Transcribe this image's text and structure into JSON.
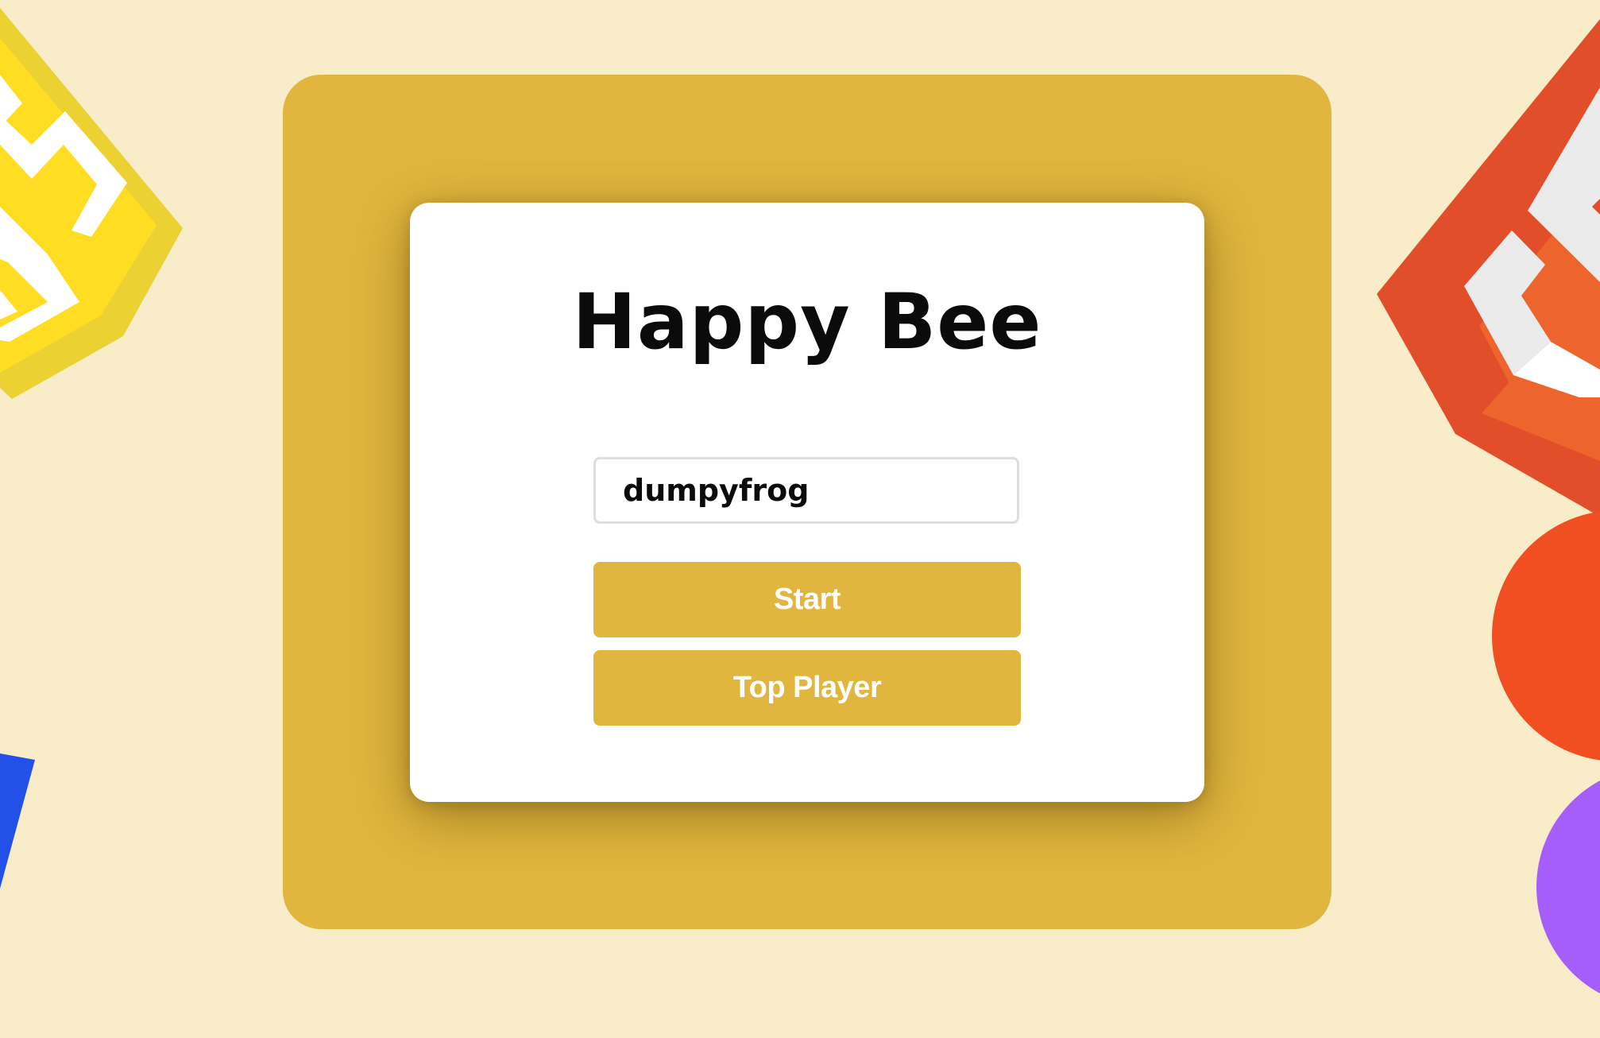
{
  "app": {
    "title": "Happy Bee"
  },
  "login_form": {
    "username_value": "dumpyfrog",
    "start_label": "Start",
    "top_player_label": "Top Player"
  },
  "colors": {
    "page_background": "#f8ecc9",
    "frame": "#e1b63e",
    "card": "#ffffff",
    "button": "#e1b63e",
    "button_text": "#ffffff",
    "title_text": "#0b0b0b"
  },
  "decorations": {
    "top_left": "yellow-diamond-maze-icon",
    "top_right": "orange-diamond-maze-icon",
    "right_middle": "orange-circle",
    "right_bottom": "purple-circle",
    "left_bottom": "blue-shape"
  }
}
